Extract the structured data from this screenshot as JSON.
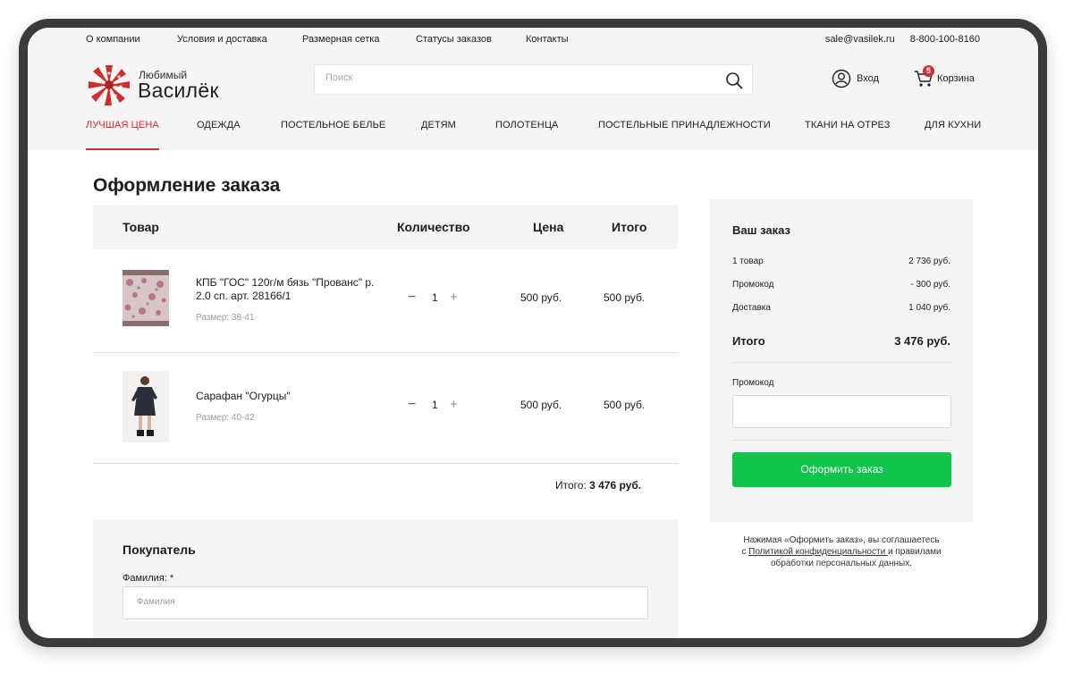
{
  "topbar": {
    "links": [
      "О компании",
      "Условия и доставка",
      "Размерная сетка",
      "Статусы заказов",
      "Контакты"
    ],
    "email": "sale@vasilek.ru",
    "phone": "8-800-100-8160"
  },
  "logo": {
    "small": "Любимый",
    "big": "Василёк"
  },
  "search": {
    "placeholder": "Поиск",
    "icon": "search-icon"
  },
  "user": {
    "login_label": "Вход",
    "cart_label": "Корзина",
    "cart_count": "5"
  },
  "nav": [
    "ЛУЧШАЯ ЦЕНА",
    "ОДЕЖДА",
    "ПОСТЕЛЬНОЕ БЕЛЬЕ",
    "ДЕТЯМ",
    "ПОЛОТЕНЦА",
    "ПОСТЕЛЬНЫЕ ПРИНАДЛЕЖНОСТИ",
    "ТКАНИ НА ОТРЕЗ",
    "ДЛЯ КУХНИ"
  ],
  "page": {
    "title": "Оформление заказа"
  },
  "cart": {
    "headers": {
      "product": "Товар",
      "qty": "Количество",
      "price": "Цена",
      "total": "Итого"
    },
    "items": [
      {
        "name": "КПБ \"ГОС\" 120г/м бязь \"Прованс\" р. 2.0 сп. арт. 28166/1",
        "size": "Размер: 38-41",
        "qty": "1",
        "price": "500 руб.",
        "total": "500 руб."
      },
      {
        "name": "Сарафан \"Огурцы\"",
        "size": "Размер: 40-42",
        "qty": "1",
        "price": "500 руб.",
        "total": "500 руб."
      }
    ],
    "grand_label": "Итого:",
    "grand_value": "3 476 руб."
  },
  "buyer": {
    "title": "Покупатель",
    "lastname_label": "Фамилия: *",
    "lastname_placeholder": "Фамилия"
  },
  "summary": {
    "title": "Ваш заказ",
    "lines": [
      {
        "label": "1 товар",
        "value": "2 736 руб."
      },
      {
        "label": "Промокод",
        "value": "- 300 руб."
      },
      {
        "label": "Доставка",
        "value": "1 040 руб."
      }
    ],
    "total_label": "Итого",
    "total_value": "3 476 руб.",
    "promo_label": "Промокод",
    "order_button": "Оформить заказ"
  },
  "agreement": {
    "line1": "Нажимая «Оформить заказ», вы соглашаетесь",
    "prefix": "с ",
    "link": "Политикой конфиденциальности ",
    "line2_rest": "и правилами",
    "line3": "обработки персональных данных."
  },
  "colors": {
    "accent": "#d02d2d",
    "order_button": "#0fc64a",
    "panel": "#f5f5f5"
  }
}
